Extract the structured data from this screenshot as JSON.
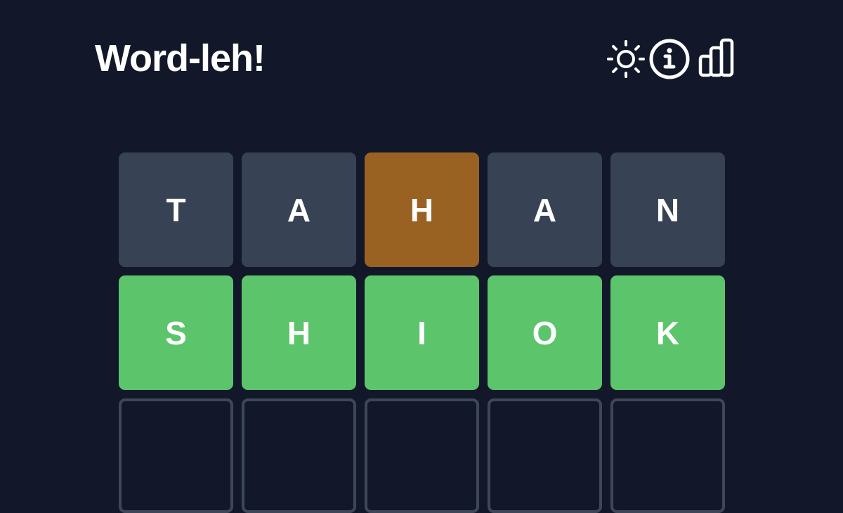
{
  "header": {
    "title": "Word-leh!",
    "icons": [
      "sun-icon",
      "info-icon",
      "chart-icon"
    ]
  },
  "board": {
    "rows": [
      {
        "tiles": [
          {
            "letter": "T",
            "state": "absent"
          },
          {
            "letter": "A",
            "state": "absent"
          },
          {
            "letter": "H",
            "state": "present"
          },
          {
            "letter": "A",
            "state": "absent"
          },
          {
            "letter": "N",
            "state": "absent"
          }
        ]
      },
      {
        "tiles": [
          {
            "letter": "S",
            "state": "correct"
          },
          {
            "letter": "H",
            "state": "correct"
          },
          {
            "letter": "I",
            "state": "correct"
          },
          {
            "letter": "O",
            "state": "correct"
          },
          {
            "letter": "K",
            "state": "correct"
          }
        ]
      },
      {
        "tiles": [
          {
            "letter": "",
            "state": "empty"
          },
          {
            "letter": "",
            "state": "empty"
          },
          {
            "letter": "",
            "state": "empty"
          },
          {
            "letter": "",
            "state": "empty"
          },
          {
            "letter": "",
            "state": "empty"
          }
        ]
      }
    ]
  },
  "colors": {
    "background": "#121829",
    "absent": "#374254",
    "present": "#996223",
    "correct": "#5cc46b",
    "empty_border": "#3e4758",
    "text": "#ffffff"
  }
}
